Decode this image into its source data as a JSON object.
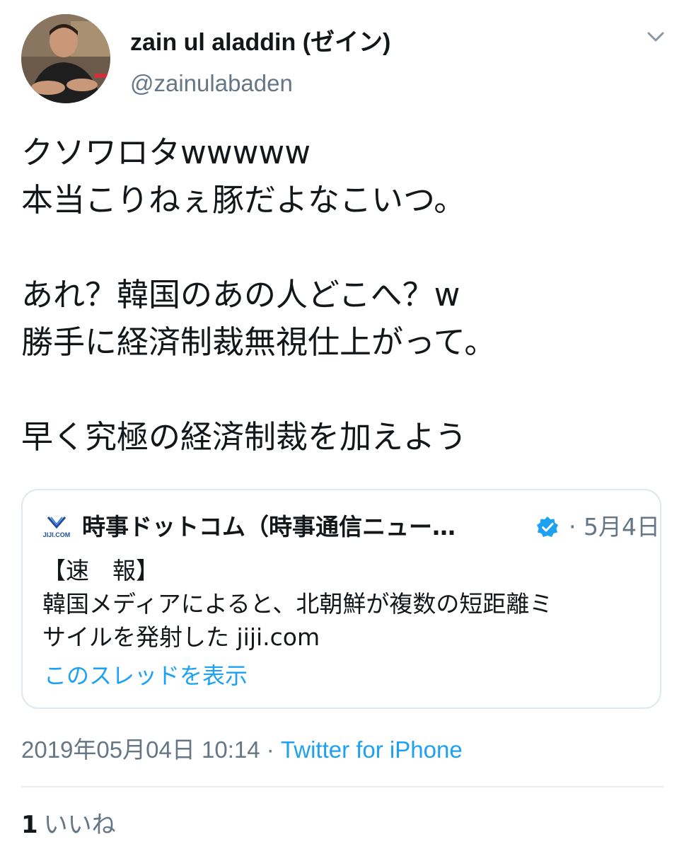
{
  "tweet": {
    "author": {
      "display_name": "zain ul aladdin (ゼイン)",
      "handle": "@zainulabaden",
      "avatar_icon": "user-avatar"
    },
    "menu_icon": "chevron-down-icon",
    "text_lines": [
      "クソワロタwwwww",
      "本当こりねぇ豚だよなこいつ。",
      "",
      "あれ？韓国のあの人どこへ？w",
      "勝手に経済制裁無視仕上がって。",
      "",
      "早く究極の経済制裁を加えよう"
    ],
    "quoted": {
      "logo_icon": "jiji-logo",
      "logo_text": "JIJI.COM",
      "name": "時事ドットコム（時事通信ニュー…",
      "verified_icon": "verified-badge-icon",
      "date": "· 5月4日",
      "body_lines": [
        "【速　報】",
        "韓国メディアによると、北朝鮮が複数の短距離ミ",
        "サイルを発射した jiji.com"
      ],
      "thread_link": "このスレッドを表示"
    },
    "timestamp": "2019年05月04日 10:14 · ",
    "source": "Twitter for iPhone",
    "likes_count": "1",
    "likes_label": "いいね"
  },
  "colors": {
    "text": "#14171a",
    "secondary": "#657786",
    "link": "#1da1f2",
    "border": "#e1e8ed",
    "verified": "#1da1f2"
  }
}
